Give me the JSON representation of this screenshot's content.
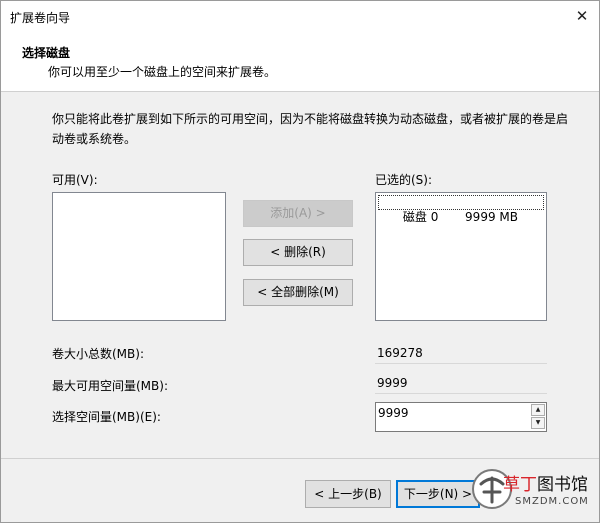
{
  "window": {
    "title": "扩展卷向导",
    "close_glyph": "✕"
  },
  "header": {
    "title": "选择磁盘",
    "subtitle": "你可以用至少一个磁盘上的空间来扩展卷。"
  },
  "description": "你只能将此卷扩展到如下所示的可用空间，因为不能将磁盘转换为动态磁盘，或者被扩展的卷是启动卷或系统卷。",
  "available": {
    "label": "可用(V):",
    "items": []
  },
  "selected": {
    "label": "已选的(S):",
    "items": [
      {
        "disk": "磁盘 0",
        "size": "9999 MB"
      }
    ]
  },
  "buttons": {
    "add": "添加(A) >",
    "remove": "< 删除(R)",
    "remove_all": "< 全部删除(M)"
  },
  "fields": {
    "total_label": "卷大小总数(MB):",
    "total_value": "169278",
    "max_label": "最大可用空间量(MB):",
    "max_value": "9999",
    "select_label": "选择空间量(MB)(E):",
    "select_value": "9999"
  },
  "footer": {
    "back": "< 上一步(B)",
    "next": "下一步(N) >"
  },
  "watermark": {
    "line1_red": "草丁",
    "line1_rest": "图书馆",
    "line2": "SMZDM.COM"
  },
  "colors": {
    "accent": "#0078d7",
    "disabled_text": "#9a9a9a",
    "watermark_red": "#d9262c"
  },
  "icons": {
    "close": "close-icon",
    "spin_up": "spin-up-icon",
    "spin_down": "spin-down-icon"
  }
}
